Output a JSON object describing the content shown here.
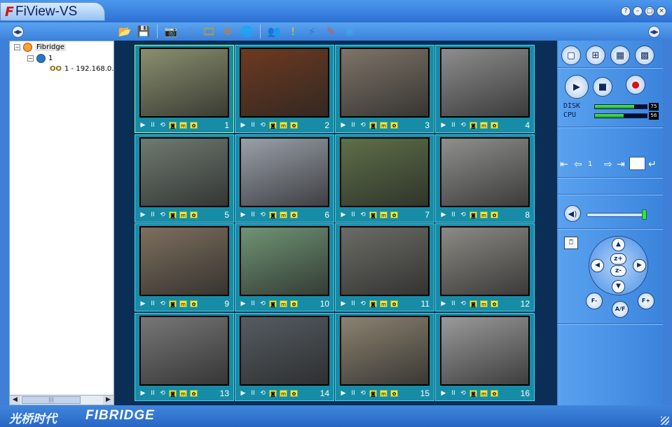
{
  "app": {
    "title": "FiView-VS",
    "logo": "F"
  },
  "window_buttons": [
    {
      "name": "help",
      "glyph": "?"
    },
    {
      "name": "minimize",
      "glyph": "–"
    },
    {
      "name": "maximize",
      "glyph": "□"
    },
    {
      "name": "close",
      "glyph": "×"
    }
  ],
  "toolbar": {
    "collapse_left": "◀▶",
    "collapse_right": "◀▶",
    "tools": [
      {
        "icon": "open-folder-icon",
        "glyph": "📂",
        "color": "#e8b830"
      },
      {
        "icon": "save-icon",
        "glyph": "💾",
        "color": "#2f58b8"
      },
      {
        "icon": "snapshot-icon",
        "glyph": "📷",
        "color": "#777"
      },
      {
        "icon": "schedule-icon",
        "glyph": "⏱",
        "color": "#5a8bd6"
      },
      {
        "icon": "playback-icon",
        "glyph": "🎞",
        "color": "#c79b2a"
      },
      {
        "icon": "config-icon",
        "glyph": "⚙",
        "color": "#d87a23"
      },
      {
        "icon": "network-icon",
        "glyph": "🌐",
        "color": "#3aa14b"
      },
      {
        "icon": "users-icon",
        "glyph": "👥",
        "color": "#d44"
      },
      {
        "icon": "alarm-icon",
        "glyph": "!",
        "color": "#f5c800"
      },
      {
        "icon": "connect-icon",
        "glyph": "⚡",
        "color": "#3a72d0"
      },
      {
        "icon": "erase-icon",
        "glyph": "✎",
        "color": "#e05535"
      },
      {
        "icon": "about-icon",
        "glyph": "◉",
        "color": "#3fa5e8"
      }
    ]
  },
  "tree": {
    "root": "Fibridge",
    "group": "1",
    "device": "1 - 192.168.0."
  },
  "cameras": [
    {
      "num": "1",
      "tag": "",
      "scene": "#8a8f6e"
    },
    {
      "num": "2",
      "tag": "",
      "scene": "#6d3a20"
    },
    {
      "num": "3",
      "tag": "",
      "scene": "#7e7468"
    },
    {
      "num": "4",
      "tag": "",
      "scene": "#8d8d8d"
    },
    {
      "num": "5",
      "tag": "",
      "scene": "#6f7a70"
    },
    {
      "num": "6",
      "tag": "",
      "scene": "#9aa0aa"
    },
    {
      "num": "7",
      "tag": "",
      "scene": "#5e7048"
    },
    {
      "num": "8",
      "tag": "",
      "scene": "#8f8f8c"
    },
    {
      "num": "9",
      "tag": "",
      "scene": "#7d6f5e"
    },
    {
      "num": "10",
      "tag": "",
      "scene": "#6f9474"
    },
    {
      "num": "11",
      "tag": "",
      "scene": "#6c6c66"
    },
    {
      "num": "12",
      "tag": "",
      "scene": "#8c8a84"
    },
    {
      "num": "13",
      "tag": "",
      "scene": "#777"
    },
    {
      "num": "14",
      "tag": "",
      "scene": "#555c62"
    },
    {
      "num": "15",
      "tag": "",
      "scene": "#8b8270"
    },
    {
      "num": "16",
      "tag": "",
      "scene": "#9a9a9a"
    }
  ],
  "cell_controls": [
    "▶",
    "II",
    "⟲",
    "◙",
    "m",
    "✿"
  ],
  "right": {
    "layout_buttons": [
      "▢",
      "⊞",
      "▦",
      "▩"
    ],
    "disk_label": "DISK",
    "disk_pct": "75",
    "disk_value": 0.75,
    "cpu_label": "CPU",
    "cpu_pct": "56",
    "cpu_value": 0.56,
    "page": "1",
    "volume": 0.96,
    "zoom_in": "z+",
    "zoom_out": "z-",
    "focus_minus": "F-",
    "focus_plus": "F+",
    "auto_focus": "A/F"
  },
  "status": {
    "brand_cn": "光桥时代",
    "brand": "FIBRIDGE"
  },
  "colors": {
    "panel": "#3f7fd8",
    "grid_bg": "#0b2e57",
    "cell": "#178ca7",
    "bar_fill": "#2fcf2f"
  }
}
